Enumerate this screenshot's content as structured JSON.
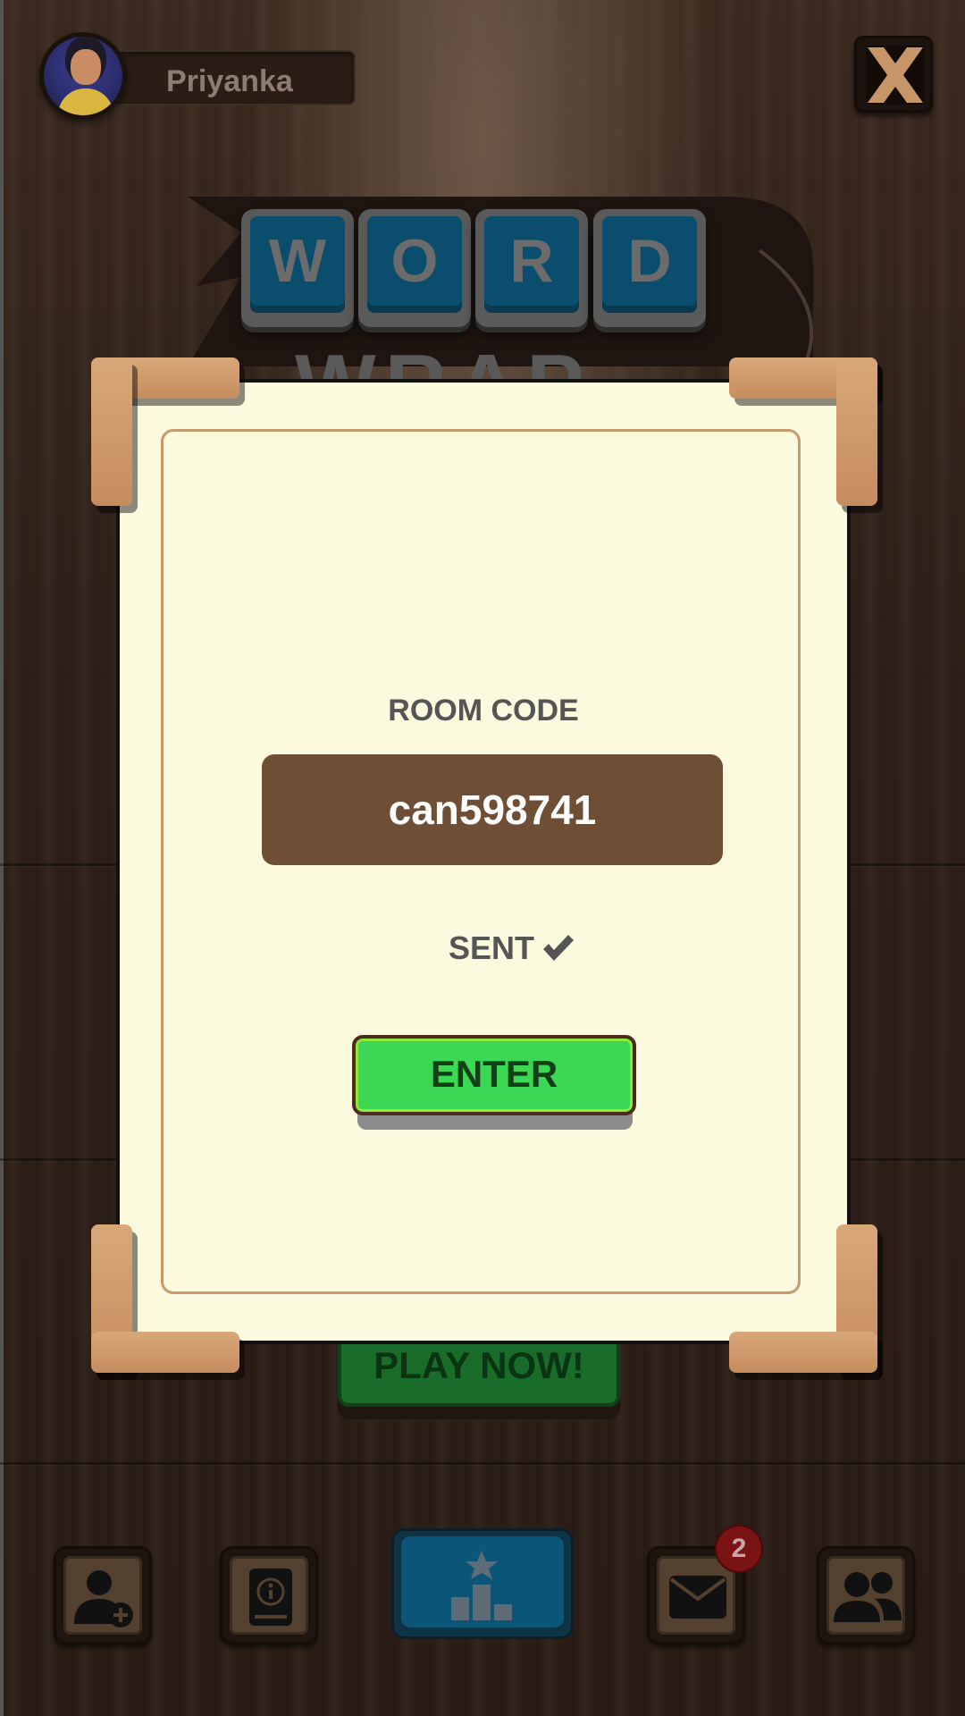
{
  "player": {
    "name": "Priyanka",
    "avatar_icon": "player-avatar"
  },
  "header": {
    "close_icon": "close-icon"
  },
  "logo": {
    "tiles": [
      "W",
      "O",
      "R",
      "D"
    ],
    "subtitle": "WRAP"
  },
  "dialog": {
    "room_code_label": "ROOM CODE",
    "room_code": "can598741",
    "status_text": "SENT",
    "status_icon": "checkmark-icon",
    "enter_label": "ENTER"
  },
  "main": {
    "play_label": "PLAY NOW!"
  },
  "bottom_nav": {
    "items": [
      {
        "icon": "add-friend-icon"
      },
      {
        "icon": "info-book-icon"
      },
      {
        "icon": "leaderboard-icon"
      },
      {
        "icon": "mail-icon",
        "badge": "2"
      },
      {
        "icon": "friends-icon"
      }
    ]
  },
  "colors": {
    "dialog_bg": "#fbfadf",
    "code_box": "#6e4f36",
    "enter_button": "#3dd756",
    "corner_wood": "#c68c5e",
    "badge": "#7a1414"
  }
}
